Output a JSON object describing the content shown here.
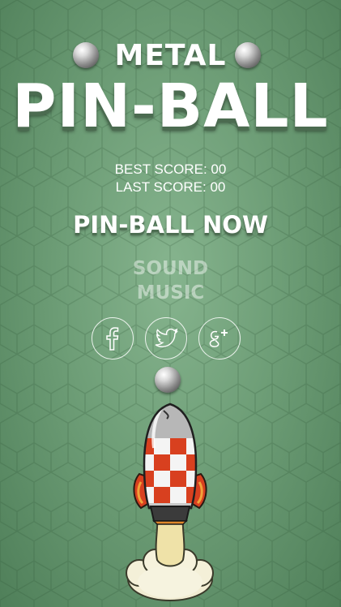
{
  "header": {
    "title_top": "METAL",
    "title_main": "PIN-BALL"
  },
  "scores": {
    "best": "BEST SCORE: 00",
    "last": "LAST SCORE: 00"
  },
  "menu": {
    "play_label": "PIN-BALL NOW",
    "sound_label": "SOUND",
    "music_label": "MUSIC"
  },
  "social": {
    "items": [
      {
        "name": "facebook",
        "glyph": "f"
      },
      {
        "name": "twitter",
        "glyph": "twitter-bird"
      },
      {
        "name": "google-plus",
        "glyph": "g+"
      }
    ]
  },
  "colors": {
    "background": "#6e9e77",
    "title": "#ffffff",
    "title_shadow": "#4d6e52",
    "rocket_red": "#d8401f"
  }
}
